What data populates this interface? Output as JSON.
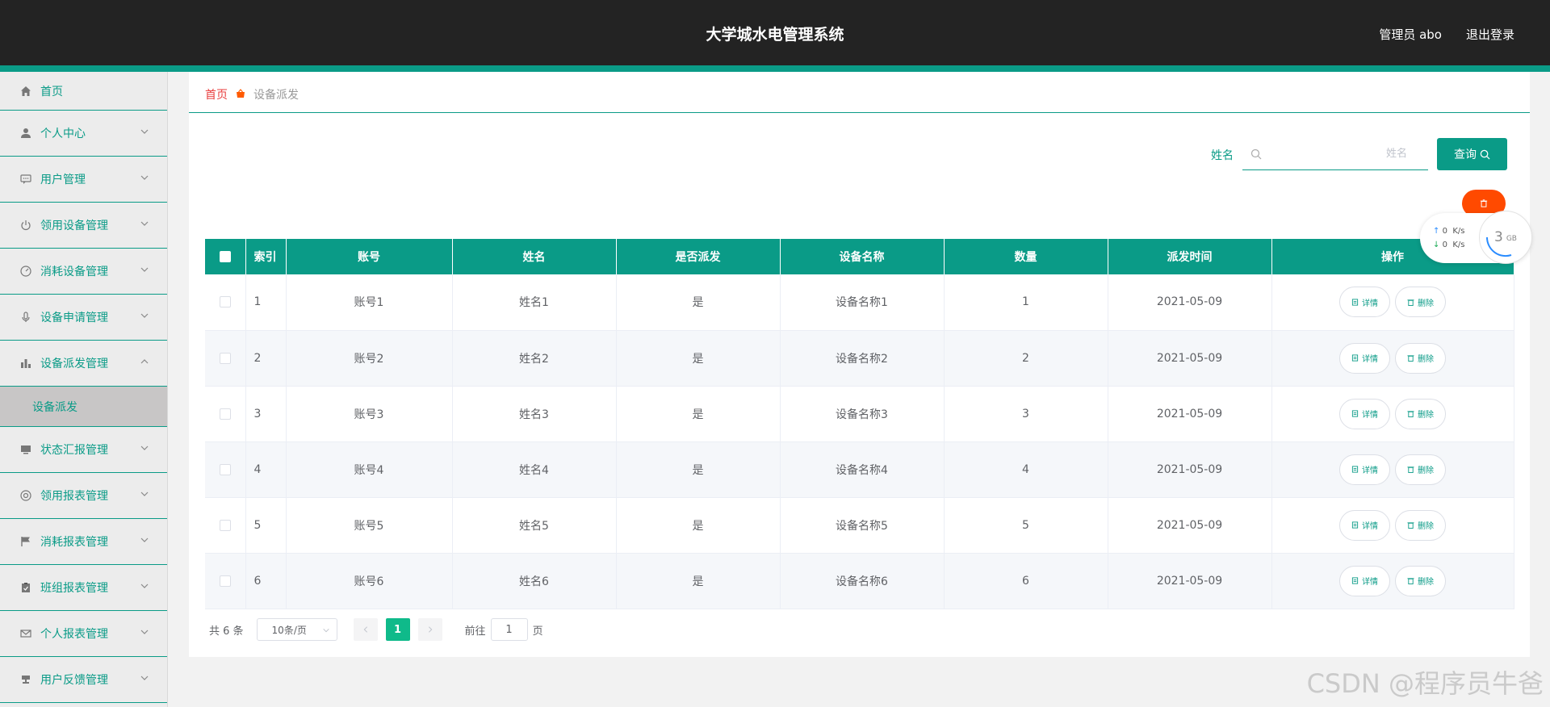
{
  "header": {
    "title": "大学城水电管理系统",
    "user": "管理员 abo",
    "logout": "退出登录"
  },
  "sidebar": {
    "items": [
      {
        "label": "首页",
        "icon": "home-icon"
      },
      {
        "label": "个人中心",
        "icon": "user-icon"
      },
      {
        "label": "用户管理",
        "icon": "chat-icon"
      },
      {
        "label": "领用设备管理",
        "icon": "power-icon"
      },
      {
        "label": "消耗设备管理",
        "icon": "gauge-icon"
      },
      {
        "label": "设备申请管理",
        "icon": "mic-icon"
      },
      {
        "label": "设备派发管理",
        "icon": "bar-chart-icon",
        "expanded": true
      },
      {
        "label": "状态汇报管理",
        "icon": "monitor-icon"
      },
      {
        "label": "领用报表管理",
        "icon": "support-icon"
      },
      {
        "label": "消耗报表管理",
        "icon": "flag-icon"
      },
      {
        "label": "班组报表管理",
        "icon": "clipboard-icon"
      },
      {
        "label": "个人报表管理",
        "icon": "mail-icon"
      },
      {
        "label": "用户反馈管理",
        "icon": "stamp-icon"
      }
    ],
    "sub_active": "设备派发"
  },
  "breadcrumb": {
    "home": "首页",
    "current": "设备派发"
  },
  "search": {
    "label": "姓名",
    "placeholder": "姓名",
    "button": "查询"
  },
  "net": {
    "up": "0",
    "down": "0",
    "unit": "K/s",
    "mem_value": "3",
    "mem_unit": "GB"
  },
  "table": {
    "headers": [
      "索引",
      "账号",
      "姓名",
      "是否派发",
      "设备名称",
      "数量",
      "派发时间",
      "操作"
    ],
    "rows": [
      {
        "idx": "1",
        "account": "账号1",
        "name": "姓名1",
        "dispatched": "是",
        "device": "设备名称1",
        "qty": "1",
        "time": "2021-05-09"
      },
      {
        "idx": "2",
        "account": "账号2",
        "name": "姓名2",
        "dispatched": "是",
        "device": "设备名称2",
        "qty": "2",
        "time": "2021-05-09"
      },
      {
        "idx": "3",
        "account": "账号3",
        "name": "姓名3",
        "dispatched": "是",
        "device": "设备名称3",
        "qty": "3",
        "time": "2021-05-09"
      },
      {
        "idx": "4",
        "account": "账号4",
        "name": "姓名4",
        "dispatched": "是",
        "device": "设备名称4",
        "qty": "4",
        "time": "2021-05-09"
      },
      {
        "idx": "5",
        "account": "账号5",
        "name": "姓名5",
        "dispatched": "是",
        "device": "设备名称5",
        "qty": "5",
        "time": "2021-05-09"
      },
      {
        "idx": "6",
        "account": "账号6",
        "name": "姓名6",
        "dispatched": "是",
        "device": "设备名称6",
        "qty": "6",
        "time": "2021-05-09"
      }
    ],
    "detail_label": "详情",
    "delete_label": "删除"
  },
  "pagination": {
    "total": "共 6 条",
    "page_size": "10条/页",
    "current": "1",
    "goto_prefix": "前往",
    "goto_value": "1",
    "goto_suffix": "页"
  },
  "watermark": "CSDN @程序员牛爸",
  "colors": {
    "accent": "#0a9b87",
    "header_bg": "#232323",
    "danger": "#ff4a00"
  }
}
